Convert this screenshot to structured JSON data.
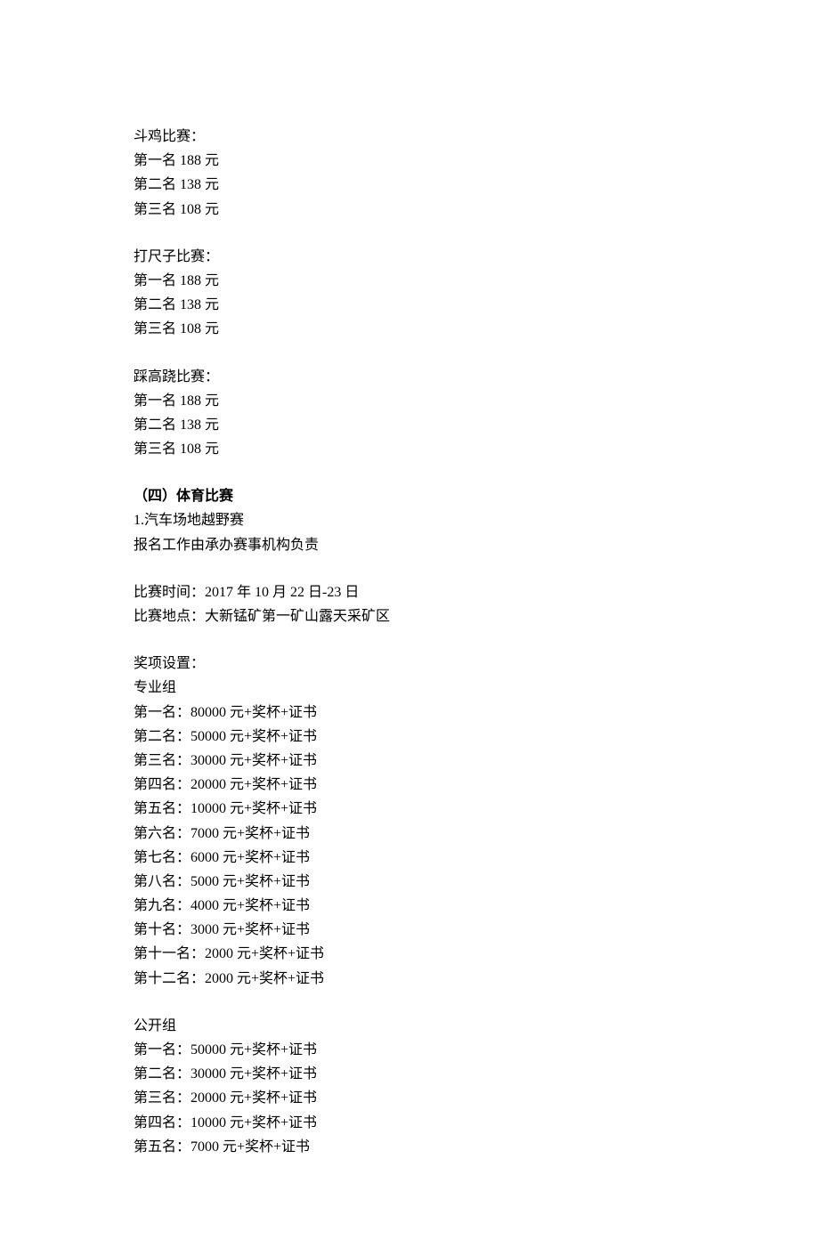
{
  "competitions": [
    {
      "title": "斗鸡比赛：",
      "ranks": [
        "第一名 188 元",
        "第二名 138 元",
        "第三名 108 元"
      ]
    },
    {
      "title": "打尺子比赛：",
      "ranks": [
        "第一名 188 元",
        "第二名 138 元",
        "第三名 108 元"
      ]
    },
    {
      "title": "踩高跷比赛：",
      "ranks": [
        "第一名 188 元",
        "第二名 138 元",
        "第三名 108 元"
      ]
    }
  ],
  "sports_heading": "（四）体育比赛",
  "offroad": {
    "title": "1.汽车场地越野赛",
    "registration": "报名工作由承办赛事机构负责",
    "time": "比赛时间：2017 年 10 月 22 日-23 日",
    "location": "比赛地点：大新锰矿第一矿山露天采矿区",
    "awards_label": "奖项设置：",
    "pro_group_label": "专业组",
    "pro_ranks": [
      "第一名：80000 元+奖杯+证书",
      "第二名：50000 元+奖杯+证书",
      "第三名：30000 元+奖杯+证书",
      "第四名：20000 元+奖杯+证书",
      "第五名：10000 元+奖杯+证书",
      "第六名：7000 元+奖杯+证书",
      "第七名：6000 元+奖杯+证书",
      "第八名：5000 元+奖杯+证书",
      "第九名：4000 元+奖杯+证书",
      "第十名：3000 元+奖杯+证书",
      "第十一名：2000 元+奖杯+证书",
      "第十二名：2000 元+奖杯+证书"
    ],
    "open_group_label": "公开组",
    "open_ranks": [
      "第一名：50000 元+奖杯+证书",
      "第二名：30000 元+奖杯+证书",
      "第三名：20000 元+奖杯+证书",
      "第四名：10000 元+奖杯+证书",
      "第五名：7000 元+奖杯+证书"
    ]
  }
}
